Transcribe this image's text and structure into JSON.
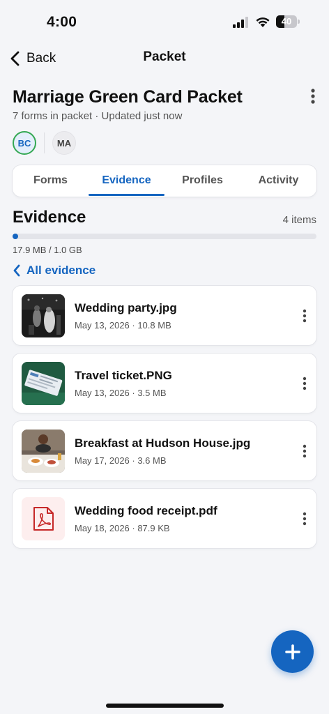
{
  "status_bar": {
    "time": "4:00",
    "battery_level": "40",
    "icons": [
      "signal-icon",
      "wifi-icon",
      "battery-icon"
    ]
  },
  "nav": {
    "back_label": "Back",
    "title": "Packet",
    "icons": [
      "chevron-left-icon"
    ]
  },
  "packet": {
    "title": "Marriage Green Card Packet",
    "subtitle": "7 forms in packet · Updated just now",
    "menu_icon": "more-vertical-icon",
    "avatars": [
      {
        "initials": "BC"
      },
      {
        "initials": "MA"
      }
    ]
  },
  "tabs": [
    {
      "label": "Forms",
      "active": false
    },
    {
      "label": "Evidence",
      "active": true
    },
    {
      "label": "Profiles",
      "active": false
    },
    {
      "label": "Activity",
      "active": false
    }
  ],
  "evidence": {
    "title": "Evidence",
    "count_label": "4 items",
    "storage_label": "17.9 MB / 1.0 GB",
    "storage_fraction": 0.0175,
    "all_evidence_label": "All evidence",
    "items": [
      {
        "name": "Wedding party.jpg",
        "meta": "May 13, 2026 · 10.8 MB",
        "thumb": "wedding-party-photo"
      },
      {
        "name": "Travel ticket.PNG",
        "meta": "May 13, 2026 · 3.5 MB",
        "thumb": "travel-ticket-photo"
      },
      {
        "name": "Breakfast at Hudson House.jpg",
        "meta": "May 17, 2026 · 3.6 MB",
        "thumb": "breakfast-photo"
      },
      {
        "name": "Wedding food receipt.pdf",
        "meta": "May 18, 2026 · 87.9 KB",
        "thumb": "pdf-icon"
      }
    ]
  },
  "fab": {
    "icon": "plus-icon"
  },
  "colors": {
    "accent": "#1565c0",
    "background": "#f4f5f8",
    "avatar_ring": "#34a853",
    "pdf_red": "#c62828"
  }
}
